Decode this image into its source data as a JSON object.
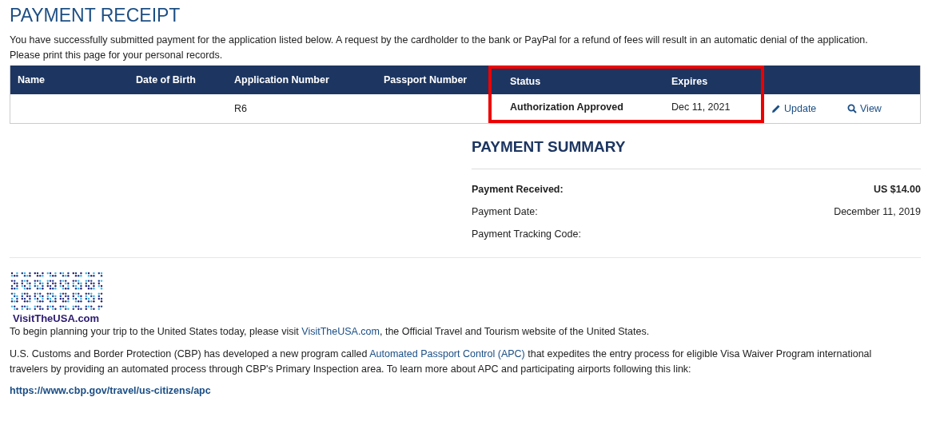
{
  "title": "PAYMENT RECEIPT",
  "intro": [
    "You have successfully submitted payment for the application listed below. A request by the cardholder to the bank or PayPal for a refund of fees will result in an automatic denial of the application.",
    "Please print this page for your personal records."
  ],
  "table": {
    "columns": [
      {
        "label": "Name",
        "highlighted": false
      },
      {
        "label": "Date of Birth",
        "highlighted": false
      },
      {
        "label": "Application Number",
        "highlighted": false
      },
      {
        "label": "Passport Number",
        "highlighted": false
      },
      {
        "label": "Status",
        "highlighted": true
      },
      {
        "label": "Expires",
        "highlighted": true
      }
    ],
    "rows": [
      {
        "cells": [
          {
            "text": ""
          },
          {
            "text": ""
          },
          {
            "text": "R6",
            "bold": false
          },
          {
            "text": ""
          },
          {
            "text": "Authorization Approved",
            "bold": true
          },
          {
            "text": "Dec 11, 2021",
            "bold": false
          }
        ],
        "actions": [
          {
            "kind": "edit",
            "label": "Update"
          },
          {
            "kind": "search",
            "label": "View"
          }
        ]
      }
    ]
  },
  "payment_summary": {
    "title": "PAYMENT SUMMARY",
    "items": [
      {
        "label": "Payment Received:",
        "value": "US $14.00",
        "bold": true
      },
      {
        "label": "Payment Date:",
        "value": "December 11, 2019",
        "bold": false
      },
      {
        "label": "Payment Tracking Code:",
        "bold": false
      }
    ]
  },
  "footer": {
    "logo_text": "VisitTheUSA.com",
    "paragraphs": [
      {
        "before": "To begin planning your trip to the United States today, please visit ",
        "link": "VisitTheUSA.com",
        "after": ", the Official Travel and Tourism website of the United States."
      },
      {
        "before": "U.S. Customs and Border Protection (CBP) has developed a new program called ",
        "link": "Automated Passport Control (APC)",
        "after": " that expedites the entry process for eligible Visa Waiver Program international travelers by providing an automated process through CBP's Primary Inspection area. To learn more about APC and participating airports following this link:"
      }
    ],
    "url": "https://www.cbp.gov/travel/us-citizens/apc"
  }
}
